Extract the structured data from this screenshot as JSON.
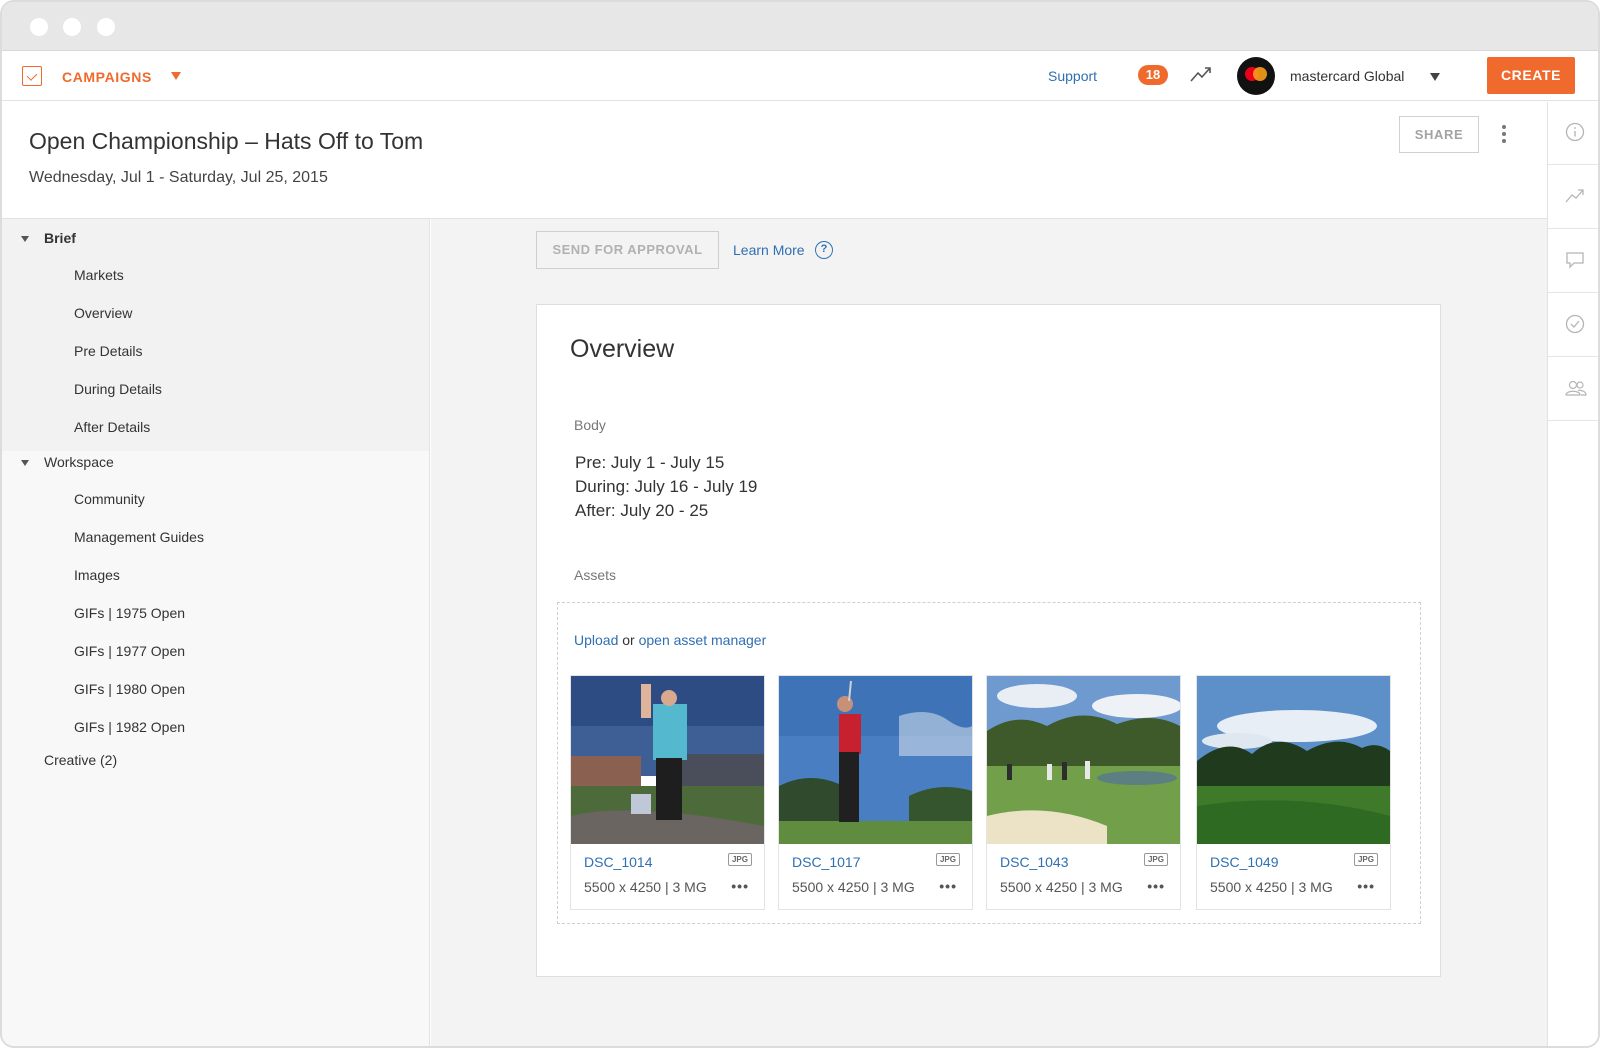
{
  "topbar": {
    "app_section": "CAMPAIGNS",
    "support_label": "Support",
    "notification_count": "18",
    "account_name": "mastercard Global",
    "create_label": "CREATE",
    "accent_color": "#ef6a2c"
  },
  "header": {
    "title": "Open Championship – Hats Off to Tom",
    "dates": "Wednesday, Jul 1 - Saturday, Jul 25, 2015",
    "share_label": "SHARE"
  },
  "right_rail": {
    "icons": [
      "info-icon",
      "trend-icon",
      "comment-icon",
      "check-circle-icon",
      "people-icon"
    ]
  },
  "sidebar": {
    "sections": [
      {
        "label": "Brief",
        "items": [
          "Markets",
          "Overview",
          "Pre Details",
          "During Details",
          "After Details"
        ]
      },
      {
        "label": "Workspace",
        "items": [
          "Community",
          "Management Guides",
          "Images",
          "GIFs | 1975 Open",
          "GIFs | 1977 Open",
          "GIFs | 1980 Open",
          "GIFs | 1982 Open"
        ]
      },
      {
        "label": "Creative (2)",
        "items": []
      }
    ]
  },
  "main": {
    "send_label": "SEND FOR APPROVAL",
    "learn_more": "Learn More",
    "card": {
      "title": "Overview",
      "body_label": "Body",
      "body_lines": [
        "Pre: July 1 - July 15",
        "During: July 16 - July 19",
        "After: July 20 - 25"
      ],
      "assets_label": "Assets",
      "upload": "Upload",
      "or": "or",
      "asset_manager": "open asset manager",
      "assets": [
        {
          "name": "DSC_1014",
          "type": "JPG",
          "dims": "5500 x 4250 | 3 MG"
        },
        {
          "name": "DSC_1017",
          "type": "JPG",
          "dims": "5500 x 4250 | 3 MG"
        },
        {
          "name": "DSC_1043",
          "type": "JPG",
          "dims": "5500 x 4250 | 3 MG"
        },
        {
          "name": "DSC_1049",
          "type": "JPG",
          "dims": "5500 x 4250 | 3 MG"
        }
      ]
    }
  }
}
